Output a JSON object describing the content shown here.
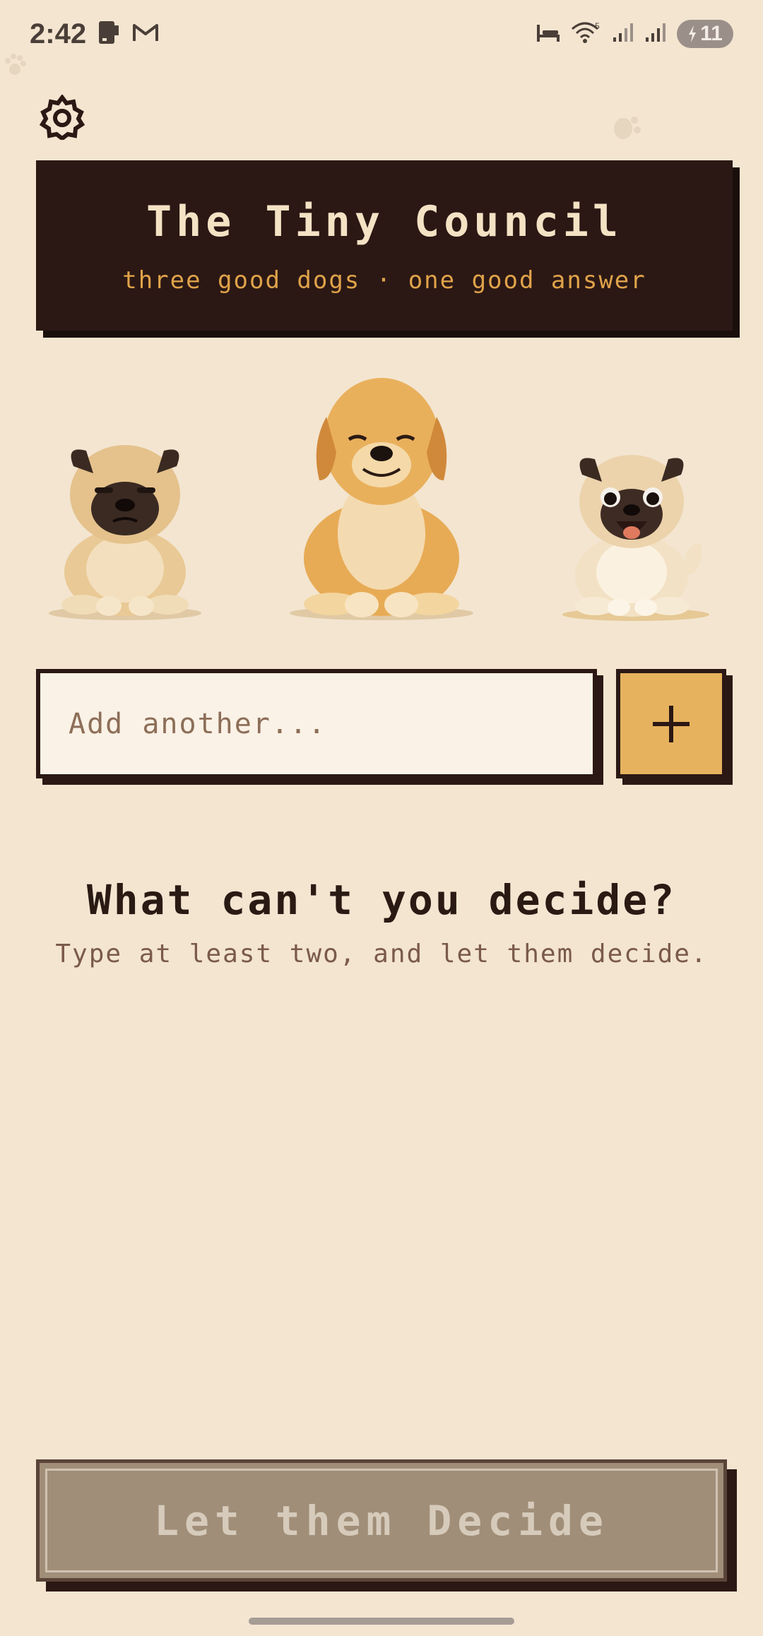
{
  "status_bar": {
    "time": "2:42",
    "battery_level": "11",
    "icons": [
      "phone-status-icon",
      "gmail-icon",
      "sleep-mode-icon",
      "wifi-icon",
      "signal-icon",
      "signal-icon-2",
      "battery-charging-icon"
    ]
  },
  "header": {
    "title": "The Tiny Council",
    "subtitle": "three good dogs · one good answer"
  },
  "settings": {
    "icon": "gear-icon"
  },
  "dogs": [
    {
      "name": "grumpy-pug",
      "kind": "pug"
    },
    {
      "name": "golden-retriever",
      "kind": "golden retriever"
    },
    {
      "name": "happy-pug",
      "kind": "pug"
    }
  ],
  "input": {
    "placeholder": "Add another...",
    "value": ""
  },
  "add_button": {
    "icon": "plus-icon"
  },
  "prompt": {
    "title": "What can't you decide?",
    "subtitle": "Type at least two, and let them decide."
  },
  "decide_button": {
    "label": "Let them Decide",
    "enabled": false
  },
  "colors": {
    "background": "#f3e5d0",
    "banner": "#2b1814",
    "banner_title": "#f4e2c4",
    "banner_subtitle": "#e0a34a",
    "add_button": "#e6b25e",
    "decide_disabled": "#a08e78"
  }
}
